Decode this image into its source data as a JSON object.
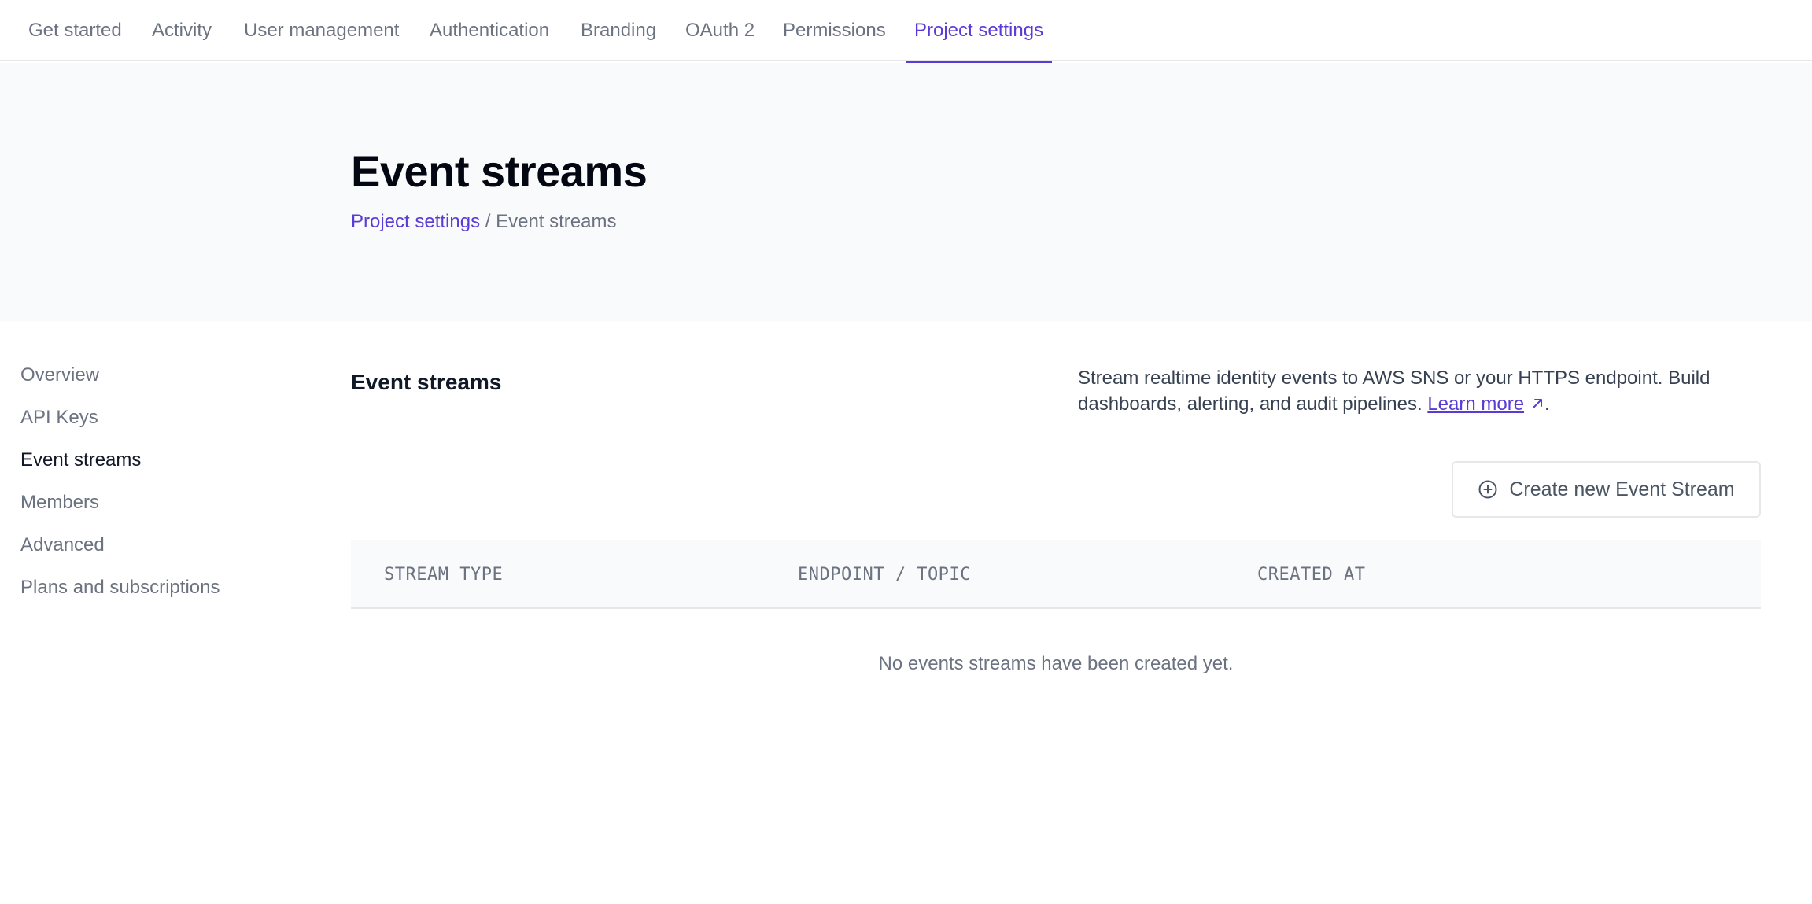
{
  "nav": {
    "tabs": [
      {
        "label": "Get started",
        "active": false
      },
      {
        "label": "Activity",
        "active": false
      },
      {
        "label": "User management",
        "active": false
      },
      {
        "label": "Authentication",
        "active": false
      },
      {
        "label": "Branding",
        "active": false
      },
      {
        "label": "OAuth 2",
        "active": false
      },
      {
        "label": "Permissions",
        "active": false
      },
      {
        "label": "Project settings",
        "active": true
      }
    ]
  },
  "hero": {
    "title": "Event streams",
    "breadcrumb": {
      "parent": "Project settings",
      "separator": "/",
      "current": "Event streams"
    }
  },
  "sidebar": {
    "items": [
      {
        "label": "Overview",
        "active": false
      },
      {
        "label": "API Keys",
        "active": false
      },
      {
        "label": "Event streams",
        "active": true
      },
      {
        "label": "Members",
        "active": false
      },
      {
        "label": "Advanced",
        "active": false
      },
      {
        "label": "Plans and subscriptions",
        "active": false
      }
    ]
  },
  "section": {
    "title": "Event streams",
    "description": "Stream realtime identity events to AWS SNS or your HTTPS endpoint. Build dashboards, alerting, and audit pipelines.",
    "learn_more": "Learn more",
    "period": ".",
    "create_button": "Create new Event Stream"
  },
  "table": {
    "columns": [
      "STREAM TYPE",
      "ENDPOINT / TOPIC",
      "CREATED AT"
    ],
    "empty_message": "No events streams have been created yet."
  },
  "colors": {
    "accent": "#5b3bd6",
    "muted_text": "#6b7280",
    "hero_bg": "#f9fafb",
    "border": "#e5e7eb"
  }
}
